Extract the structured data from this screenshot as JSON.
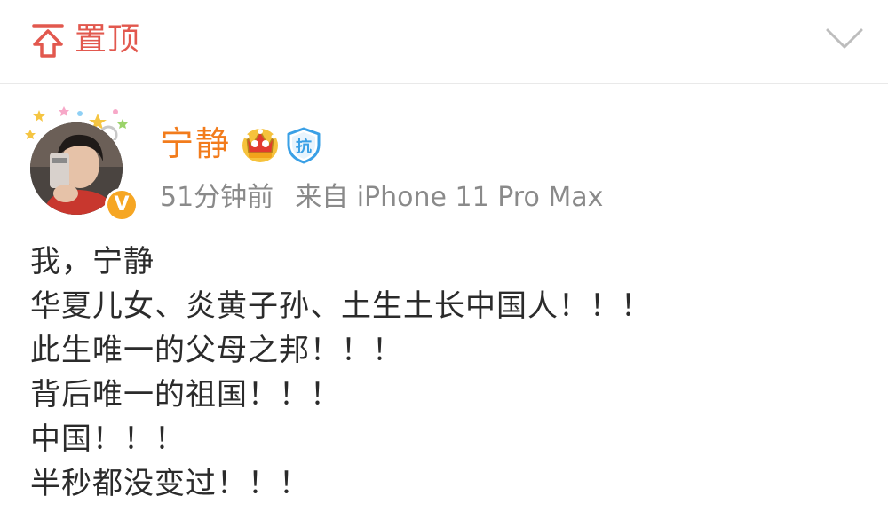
{
  "pin": {
    "icon": "pin-to-top-icon",
    "label": "置顶",
    "collapse_icon": "chevron-down-icon",
    "accent_color": "#e2584e"
  },
  "post": {
    "author": {
      "name": "宁静",
      "name_color": "#f27c1c",
      "avatar": "avatar-photo",
      "verified_badge": "V",
      "badges": [
        "crown-member-icon",
        "shield-kang-icon"
      ],
      "shield_text": "抗"
    },
    "time": "51分钟前",
    "source": "来自 iPhone 11 Pro Max",
    "lines": [
      "我，宁静",
      "华夏儿女、炎黄子孙、土生土长中国人！！！",
      "此生唯一的父母之邦！！！",
      "背后唯一的祖国！！！",
      "中国！！！",
      "半秒都没变过！！！"
    ]
  }
}
